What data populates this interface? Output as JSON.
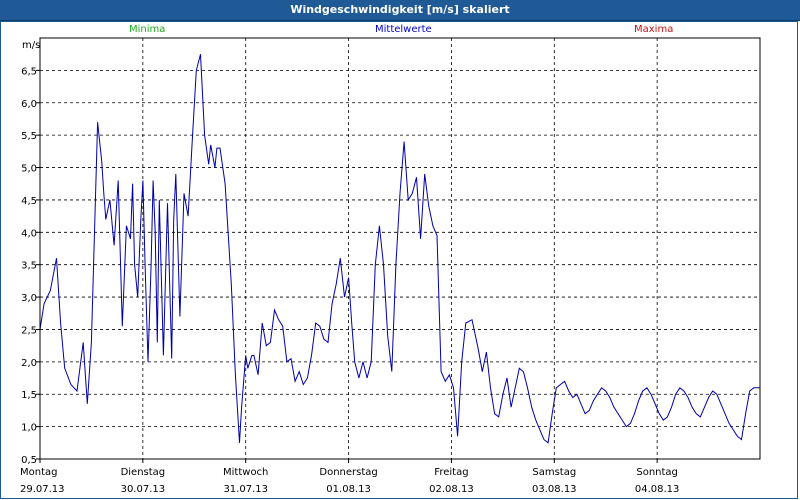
{
  "window": {
    "title": "Windgeschwindigkeit [m/s] skaliert"
  },
  "legend": {
    "minima": "Minima",
    "mittelwerte": "Mittelwerte",
    "maxima": "Maxima"
  },
  "colors": {
    "minima": "#22aa22",
    "mittelwerte": "#0000cc",
    "maxima": "#cc1111",
    "series": "#0000aa",
    "titlebar": "#1f5a96"
  },
  "chart_data": {
    "type": "line",
    "title": "Windgeschwindigkeit [m/s] skaliert",
    "ylabel": "m/s",
    "ylim": [
      0.5,
      7.0
    ],
    "yticks": [
      0.5,
      1.0,
      1.5,
      2.0,
      2.5,
      3.0,
      3.5,
      4.0,
      4.5,
      5.0,
      5.5,
      6.0,
      6.5
    ],
    "ytick_labels": [
      "0,5",
      "1,0",
      "1,5",
      "2,0",
      "2,5",
      "3,0",
      "3,5",
      "4,0",
      "4,5",
      "5,0",
      "5,5",
      "6,0",
      "6,5"
    ],
    "x_range_days": [
      0,
      7
    ],
    "x_ticks": [
      {
        "day": "Montag",
        "date": "29.07.13"
      },
      {
        "day": "Dienstag",
        "date": "30.07.13"
      },
      {
        "day": "Mittwoch",
        "date": "31.07.13"
      },
      {
        "day": "Donnerstag",
        "date": "01.08.13"
      },
      {
        "day": "Freitag",
        "date": "02.08.13"
      },
      {
        "day": "Samstag",
        "date": "03.08.13"
      },
      {
        "day": "Sonntag",
        "date": "04.08.13"
      }
    ],
    "grid": true,
    "series": [
      {
        "name": "Mittelwerte",
        "x": [
          0.0,
          0.04,
          0.1,
          0.16,
          0.2,
          0.24,
          0.3,
          0.36,
          0.42,
          0.46,
          0.5,
          0.56,
          0.6,
          0.62,
          0.64,
          0.68,
          0.72,
          0.76,
          0.8,
          0.84,
          0.88,
          0.9,
          0.92,
          0.95,
          0.98,
          1.0,
          1.02,
          1.05,
          1.08,
          1.1,
          1.12,
          1.14,
          1.16,
          1.2,
          1.24,
          1.28,
          1.3,
          1.32,
          1.36,
          1.4,
          1.44,
          1.48,
          1.52,
          1.56,
          1.6,
          1.64,
          1.66,
          1.7,
          1.72,
          1.75,
          1.8,
          1.84,
          1.86,
          1.9,
          1.94,
          1.96,
          2.0,
          2.02,
          2.06,
          2.08,
          2.12,
          2.16,
          2.2,
          2.24,
          2.28,
          2.32,
          2.36,
          2.4,
          2.44,
          2.48,
          2.52,
          2.56,
          2.6,
          2.64,
          2.68,
          2.72,
          2.76,
          2.8,
          2.84,
          2.88,
          2.92,
          2.96,
          3.0,
          3.03,
          3.06,
          3.1,
          3.14,
          3.18,
          3.22,
          3.26,
          3.3,
          3.34,
          3.38,
          3.42,
          3.46,
          3.5,
          3.54,
          3.58,
          3.62,
          3.66,
          3.7,
          3.74,
          3.78,
          3.82,
          3.86,
          3.9,
          3.94,
          3.98,
          4.02,
          4.06,
          4.1,
          4.14,
          4.2,
          4.26,
          4.3,
          4.34,
          4.38,
          4.42,
          4.46,
          4.5,
          4.54,
          4.58,
          4.62,
          4.66,
          4.7,
          4.74,
          4.78,
          4.82,
          4.86,
          4.9,
          4.94,
          4.98,
          5.02,
          5.06,
          5.1,
          5.14,
          5.18,
          5.22,
          5.26,
          5.3,
          5.34,
          5.38,
          5.42,
          5.46,
          5.5,
          5.54,
          5.58,
          5.62,
          5.66,
          5.7,
          5.74,
          5.78,
          5.82,
          5.86,
          5.9,
          5.94,
          5.98,
          6.02,
          6.06,
          6.1,
          6.14,
          6.18,
          6.22,
          6.26,
          6.3,
          6.34,
          6.38,
          6.42,
          6.46,
          6.5,
          6.54,
          6.58,
          6.62,
          6.66,
          6.7,
          6.74,
          6.78,
          6.82,
          6.86,
          6.9,
          6.94,
          6.98,
          7.0
        ],
        "y": [
          2.5,
          2.9,
          3.1,
          3.6,
          2.6,
          1.9,
          1.65,
          1.55,
          2.3,
          1.35,
          2.3,
          5.7,
          5.1,
          4.6,
          4.2,
          4.5,
          3.8,
          4.8,
          2.55,
          4.1,
          3.9,
          4.75,
          3.5,
          3.0,
          4.2,
          4.8,
          3.6,
          2.0,
          3.5,
          4.8,
          4.0,
          2.3,
          4.5,
          2.1,
          4.45,
          2.05,
          4.2,
          4.9,
          2.7,
          4.6,
          4.25,
          5.4,
          6.5,
          6.75,
          5.5,
          5.05,
          5.35,
          5.0,
          5.3,
          5.3,
          4.75,
          3.7,
          3.2,
          1.8,
          0.75,
          1.3,
          2.1,
          1.9,
          2.1,
          2.1,
          1.8,
          2.6,
          2.25,
          2.3,
          2.8,
          2.65,
          2.55,
          2.0,
          2.05,
          1.7,
          1.85,
          1.65,
          1.75,
          2.1,
          2.6,
          2.55,
          2.35,
          2.3,
          2.9,
          3.2,
          3.6,
          3.0,
          3.3,
          2.6,
          2.0,
          1.75,
          2.0,
          1.75,
          2.0,
          3.5,
          4.1,
          3.5,
          2.4,
          1.85,
          3.5,
          4.6,
          5.4,
          4.5,
          4.6,
          4.85,
          3.9,
          4.9,
          4.4,
          4.1,
          3.95,
          1.85,
          1.7,
          1.8,
          1.6,
          0.85,
          2.0,
          2.6,
          2.65,
          2.2,
          1.85,
          2.15,
          1.6,
          1.2,
          1.15,
          1.5,
          1.75,
          1.3,
          1.6,
          1.9,
          1.85,
          1.6,
          1.3,
          1.1,
          0.95,
          0.8,
          0.75,
          1.2,
          1.6,
          1.65,
          1.7,
          1.55,
          1.45,
          1.5,
          1.35,
          1.2,
          1.25,
          1.4,
          1.5,
          1.6,
          1.55,
          1.45,
          1.3,
          1.2,
          1.1,
          1.0,
          1.05,
          1.2,
          1.4,
          1.55,
          1.6,
          1.5,
          1.35,
          1.2,
          1.1,
          1.15,
          1.3,
          1.5,
          1.6,
          1.55,
          1.45,
          1.3,
          1.2,
          1.15,
          1.3,
          1.45,
          1.55,
          1.5,
          1.35,
          1.2,
          1.05,
          0.95,
          0.85,
          0.8,
          1.2,
          1.55,
          1.6,
          1.6,
          1.6
        ]
      }
    ]
  }
}
